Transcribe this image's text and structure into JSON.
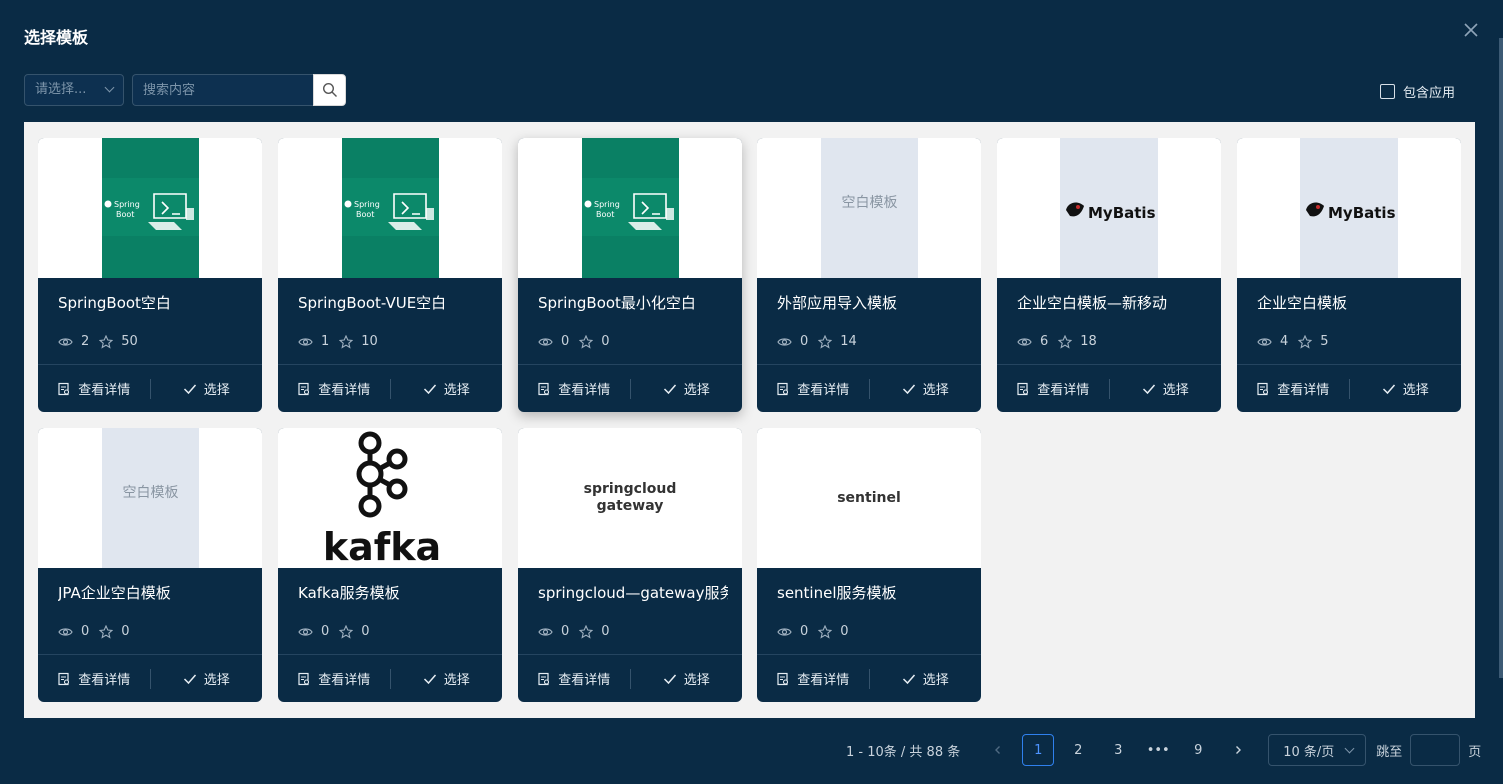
{
  "modal": {
    "title": "选择模板"
  },
  "toolbar": {
    "select_placeholder": "请选择...",
    "search_placeholder": "搜索内容",
    "include_app_label": "包含应用"
  },
  "cards": [
    {
      "title": "SpringBoot空白",
      "views": "2",
      "stars": "50",
      "thumb": "springboot"
    },
    {
      "title": "SpringBoot-VUE空白",
      "views": "1",
      "stars": "10",
      "thumb": "springboot"
    },
    {
      "title": "SpringBoot最小化空白",
      "views": "0",
      "stars": "0",
      "thumb": "springboot"
    },
    {
      "title": "外部应用导入模板",
      "views": "0",
      "stars": "14",
      "thumb": "blank",
      "thumb_text": "空白模板"
    },
    {
      "title": "企业空白模板—新移动",
      "views": "6",
      "stars": "18",
      "thumb": "mybatis",
      "thumb_text": "MyBatis"
    },
    {
      "title": "企业空白模板",
      "views": "4",
      "stars": "5",
      "thumb": "mybatis",
      "thumb_text": "MyBatis"
    },
    {
      "title": "JPA企业空白模板",
      "views": "0",
      "stars": "0",
      "thumb": "blank",
      "thumb_text": "空白模板"
    },
    {
      "title": "Kafka服务模板",
      "views": "0",
      "stars": "0",
      "thumb": "kafka",
      "thumb_text": "kafka"
    },
    {
      "title": "springcloud—gateway服务模板",
      "views": "0",
      "stars": "0",
      "thumb": "text",
      "thumb_text": "springcloud\ngateway"
    },
    {
      "title": "sentinel服务模板",
      "views": "0",
      "stars": "0",
      "thumb": "text",
      "thumb_text": "sentinel"
    }
  ],
  "card_actions": {
    "detail_label": "查看详情",
    "select_label": "选择"
  },
  "thumb_labels": {
    "spring_line1": "Spring",
    "spring_line2": "Boot"
  },
  "pagination": {
    "total_text": "1 - 10条 / 共 88 条",
    "pages": [
      "1",
      "2",
      "3",
      "•••",
      "9"
    ],
    "current": "1",
    "page_size": "10 条/页",
    "jump_label": "跳至",
    "page_suffix": "页"
  },
  "colors": {
    "background": "#0a2b45",
    "accent": "#2f80ed",
    "springboot_green": "#0a8064"
  }
}
